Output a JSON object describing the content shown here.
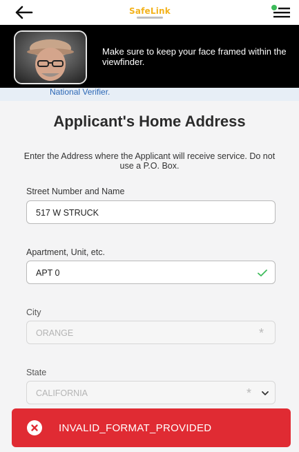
{
  "header": {
    "logo_text": "SafeLink",
    "back_icon": "arrow-left-icon",
    "menu_icon": "menu-icon",
    "brand_color": "#f3b21b",
    "notification_dot_color": "#3dbb5a"
  },
  "face_banner": {
    "message": "Make sure to keep your face framed within the viewfinder."
  },
  "verifier": {
    "text": "National Verifier."
  },
  "form": {
    "title": "Applicant's Home Address",
    "subtitle": "Enter the Address where the Applicant will receive service. Do not use a P.O. Box.",
    "street": {
      "label": "Street Number and Name",
      "value": "517 W STRUCK"
    },
    "apartment": {
      "label": "Apartment, Unit, etc.",
      "value": "APT 0",
      "status_icon": "check-icon",
      "status_color": "#3dbb5a"
    },
    "city": {
      "label": "City",
      "value": "ORANGE",
      "required_marker": "*"
    },
    "state": {
      "label": "State",
      "value": "CALIFORNIA",
      "required_marker": "*",
      "dropdown_icon": "chevron-down-icon"
    }
  },
  "toast": {
    "message": "INVALID_FORMAT_PROVIDED",
    "icon": "close-icon",
    "color": "#e02b33"
  }
}
